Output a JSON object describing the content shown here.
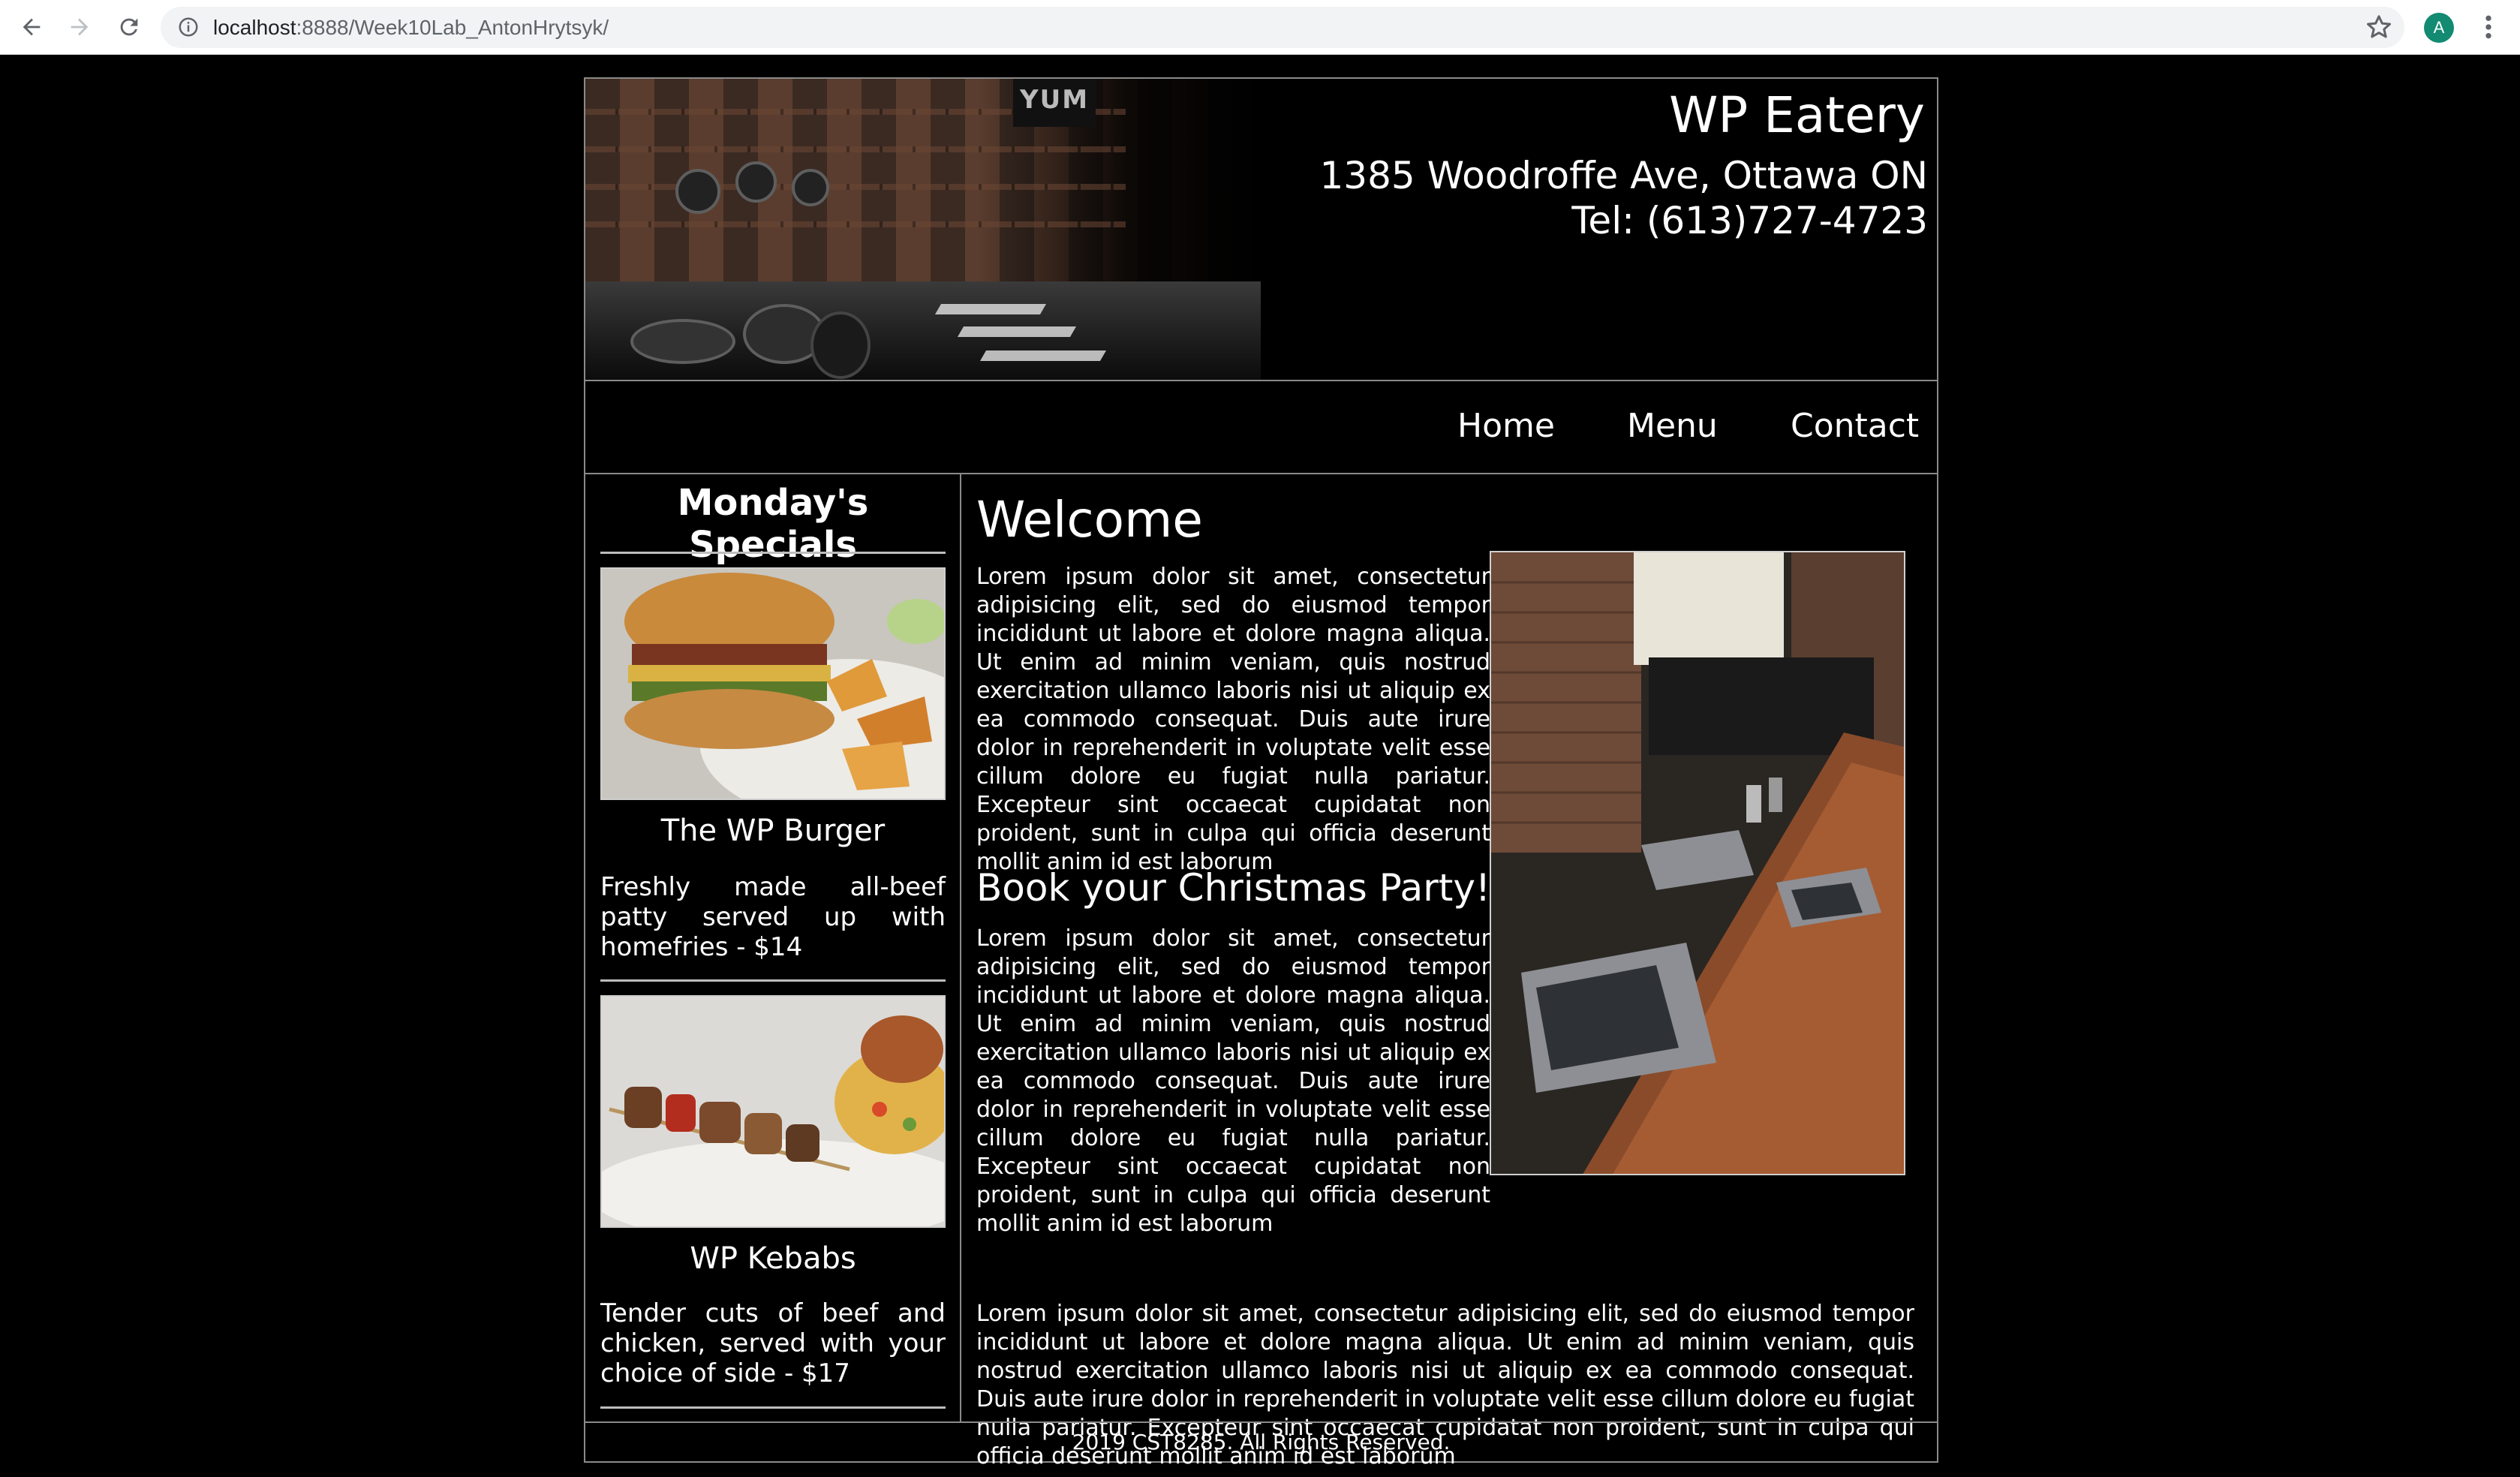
{
  "browser": {
    "url_host": "localhost",
    "url_path": ":8888/Week10Lab_AntonHrytsyk/",
    "avatar_letter": "A",
    "icons": [
      "back-arrow-icon",
      "forward-arrow-icon",
      "reload-icon",
      "info-icon",
      "star-icon",
      "kebab-menu-icon"
    ]
  },
  "header": {
    "title": "WP Eatery",
    "address": "1385 Woodroffe Ave, Ottawa ON",
    "phone": "Tel: (613)727-4723",
    "sign_text": "YUM"
  },
  "nav": {
    "items": [
      "Home",
      "Menu",
      "Contact"
    ]
  },
  "sidebar": {
    "title": "Monday's Specials",
    "specials": [
      {
        "name": "The WP Burger",
        "description": "Freshly made all-beef patty served up with homefries - $14"
      },
      {
        "name": "WP Kebabs",
        "description": "Tender cuts of beef and chicken, served with your choice of side - $17"
      }
    ]
  },
  "main": {
    "welcome_title": "Welcome",
    "paragraph1": "Lorem ipsum dolor sit amet, consectetur adipisicing elit, sed do eiusmod tempor incididunt ut labore et dolore magna aliqua. Ut enim ad minim veniam, quis nostrud exercitation ullamco laboris nisi ut aliquip ex ea commodo consequat. Duis aute irure dolor in reprehenderit in voluptate velit esse cillum dolore eu fugiat nulla pariatur. Excepteur sint occaecat cupidatat non proident, sunt in culpa qui officia deserunt mollit anim id est laborum",
    "christmas_title": "Book your Christmas Party!",
    "paragraph2": "Lorem ipsum dolor sit amet, consectetur adipisicing elit, sed do eiusmod tempor incididunt ut labore et dolore magna aliqua. Ut enim ad minim veniam, quis nostrud exercitation ullamco laboris nisi ut aliquip ex ea commodo consequat. Duis aute irure dolor in reprehenderit in voluptate velit esse cillum dolore eu fugiat nulla pariatur. Excepteur sint occaecat cupidatat non proident, sunt in culpa qui officia deserunt mollit anim id est laborum",
    "paragraph3": "Lorem ipsum dolor sit amet, consectetur adipisicing elit, sed do eiusmod tempor incididunt ut labore et dolore magna aliqua. Ut enim ad minim veniam, quis nostrud exercitation ullamco laboris nisi ut aliquip ex ea commodo consequat. Duis aute irure dolor in reprehenderit in voluptate velit esse cillum dolore eu fugiat nulla pariatur. Excepteur sint occaecat cupidatat non proident, sunt in culpa qui officia deserunt mollit anim id est laborum"
  },
  "footer": {
    "text": "2019 CST8285. All Rights Reserved."
  },
  "colors": {
    "page_bg": "#000000",
    "text": "#ffffff",
    "border": "#8a8a8a",
    "avatar": "#138a72"
  }
}
